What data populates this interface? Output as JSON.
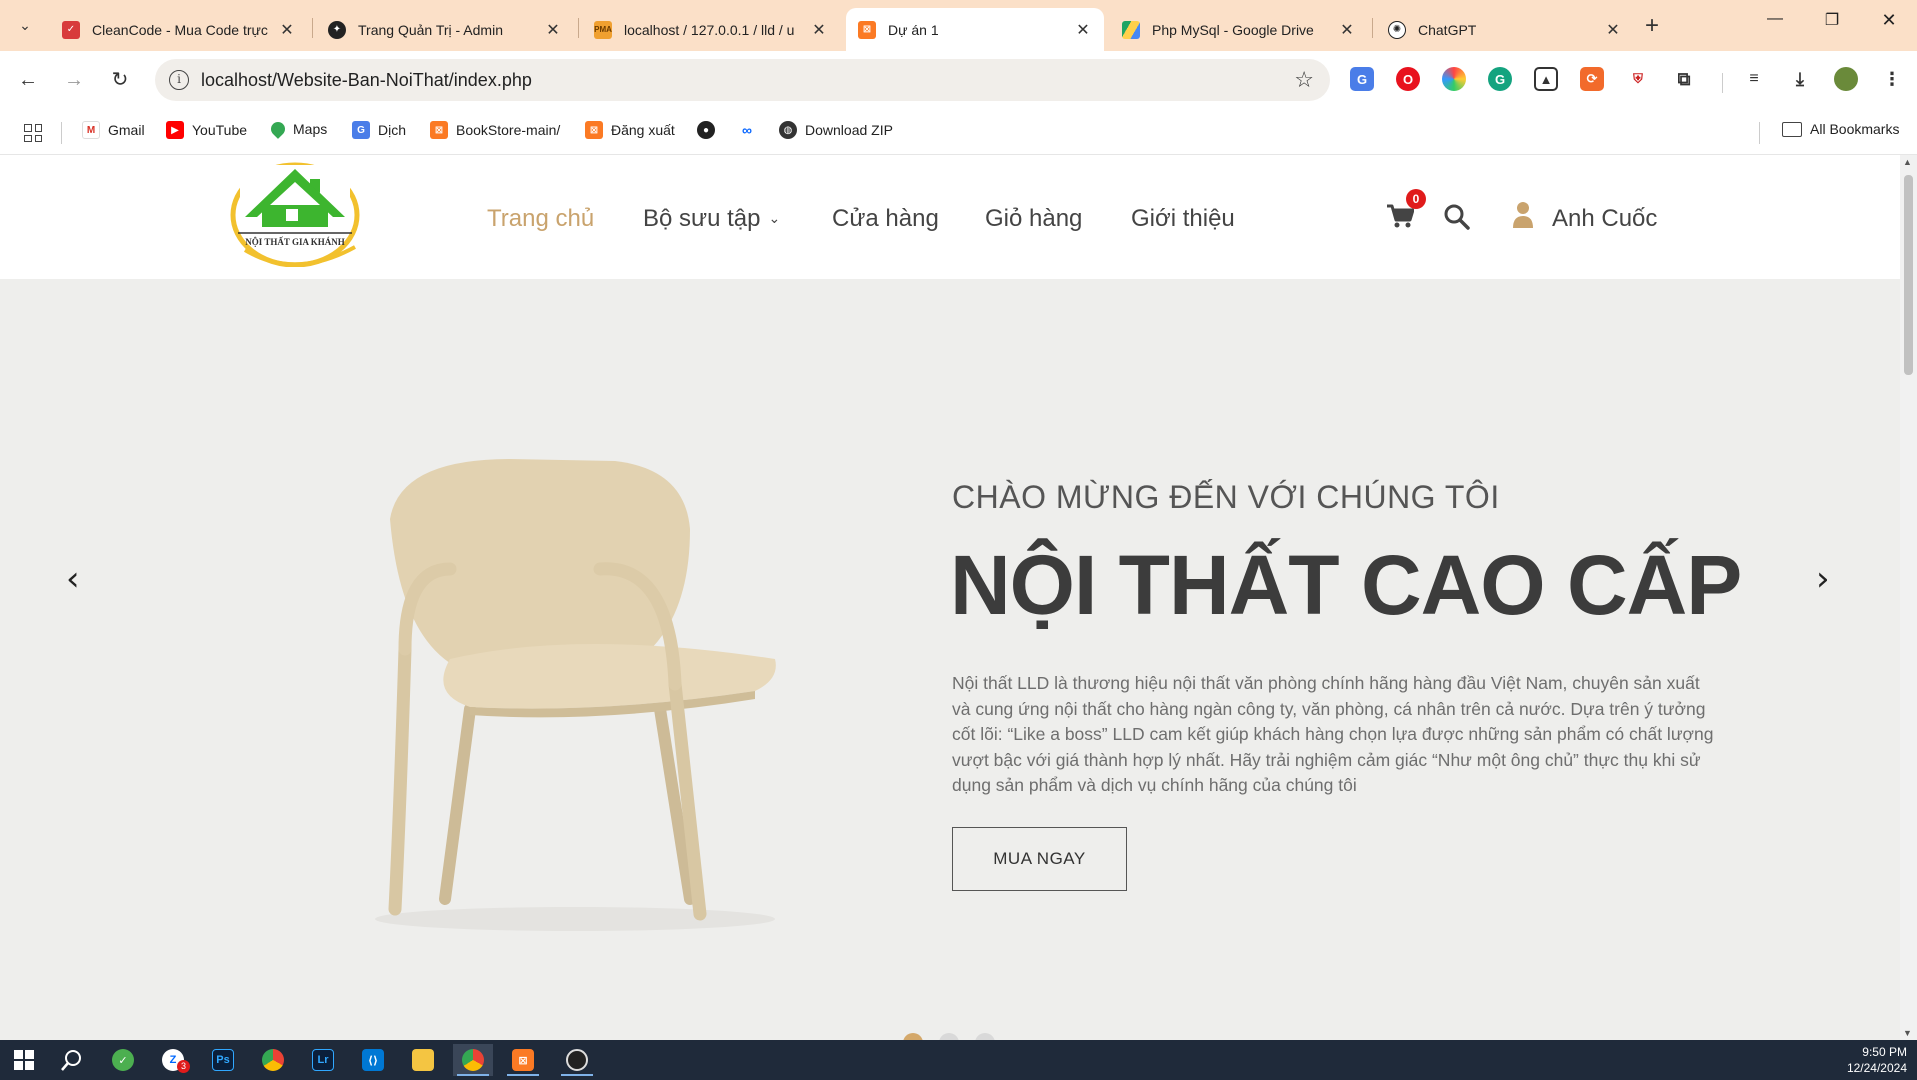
{
  "browser": {
    "tabs": [
      {
        "title": "CleanCode - Mua Code trực",
        "favicon": "cleancode-icon",
        "active": false
      },
      {
        "title": "Trang Quản Trị - Admin",
        "favicon": "admin-icon",
        "active": false
      },
      {
        "title": "localhost / 127.0.0.1 / lld / u",
        "favicon": "phpmyadmin-icon",
        "active": false
      },
      {
        "title": "Dự án 1",
        "favicon": "xampp-icon",
        "active": true
      },
      {
        "title": "Php MySql - Google Drive",
        "favicon": "google-drive-icon",
        "active": false
      },
      {
        "title": "ChatGPT",
        "favicon": "chatgpt-icon",
        "active": false
      }
    ],
    "url": "localhost/Website-Ban-NoiThat/index.php",
    "bookmarks": [
      {
        "label": "Gmail",
        "icon": "gmail-icon"
      },
      {
        "label": "YouTube",
        "icon": "youtube-icon"
      },
      {
        "label": "Maps",
        "icon": "maps-icon"
      },
      {
        "label": "Dịch",
        "icon": "translate-icon"
      },
      {
        "label": "BookStore-main/",
        "icon": "xampp-icon"
      },
      {
        "label": "Đăng xuất",
        "icon": "xampp-icon"
      },
      {
        "label": "",
        "icon": "github-icon"
      },
      {
        "label": "",
        "icon": "meta-icon"
      },
      {
        "label": "Download ZIP",
        "icon": "globe-icon"
      }
    ],
    "all_bookmarks": "All Bookmarks"
  },
  "site": {
    "logo_text": "NỘI THẤT GIA KHÁNH",
    "nav": {
      "home": "Trang chủ",
      "collection": "Bộ sưu tập",
      "shop": "Cửa hàng",
      "cart": "Giỏ hàng",
      "about": "Giới thiệu"
    },
    "cart_count": "0",
    "user_name": "Anh Cuốc"
  },
  "hero": {
    "subtitle": "CHÀO MỪNG ĐẾN VỚI CHÚNG TÔI",
    "title": "NỘI THẤT CAO CẤP",
    "description": "Nội thất LLD là thương hiệu nội thất văn phòng chính hãng hàng đầu Việt Nam, chuyên sản xuất và cung ứng nội thất cho hàng ngàn công ty, văn phòng, cá nhân trên cả nước. Dựa trên ý tưởng cốt lõi: “Like a boss” LLD cam kết giúp khách hàng chọn lựa được những sản phẩm có chất lượng vượt bậc với giá thành hợp lý nhất. Hãy trải nghiệm cảm giác “Như một ông chủ” thực thụ khi sử dụng sản phẩm và dịch vụ chính hãng của chúng tôi",
    "button": "MUA NGAY",
    "slide_count": 3,
    "active_slide": 1
  },
  "taskbar": {
    "time": "9:50 PM",
    "date": "12/24/2024",
    "zalo_badge": "3"
  },
  "colors": {
    "accent": "#c9a36d",
    "tabstrip": "#fbe0c8",
    "hero_bg": "#eeeeec",
    "badge": "#e01b1b"
  }
}
